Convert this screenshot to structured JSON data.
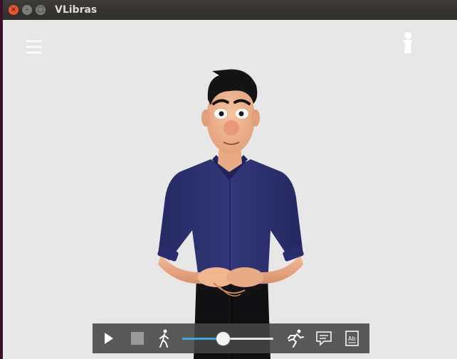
{
  "window": {
    "title": "VLibras",
    "close_glyph": "×",
    "minimize_glyph": "–",
    "maximize_glyph": "□"
  },
  "toolbar": {
    "menu_icon": "hamburger-menu-icon",
    "avatar_icon": "avatar-silhouette-icon"
  },
  "controls": {
    "play_icon": "play-icon",
    "stop_icon": "stop-icon",
    "slow_icon": "walking-person-icon",
    "fast_icon": "running-person-icon",
    "subtitle_icon": "speech-bubble-icon",
    "gloss_icon": "ab-document-icon",
    "speed_level": 0.45,
    "accent_color": "#3aa7de"
  },
  "colors": {
    "background": "#e7e7e7",
    "shirt": "#2c3070",
    "skin": "#f0b08a",
    "hair": "#141414"
  }
}
